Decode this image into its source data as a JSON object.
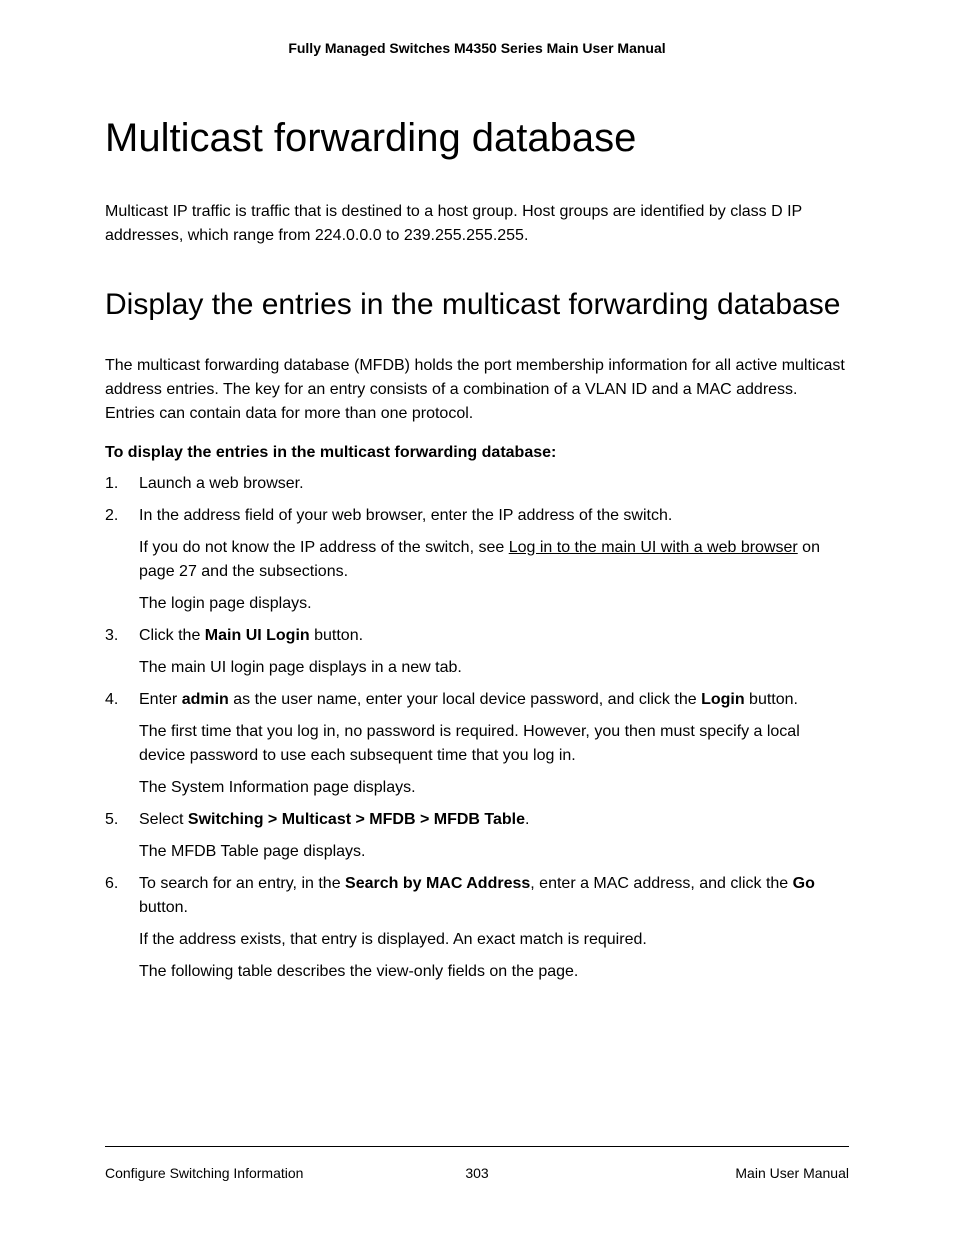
{
  "header": "Fully Managed Switches M4350 Series Main User Manual",
  "h1": "Multicast forwarding database",
  "intro": "Multicast IP traffic is traffic that is destined to a host group. Host groups are identified by class D IP addresses, which range from 224.0.0.0 to 239.255.255.255.",
  "h2": "Display the entries in the multicast forwarding database",
  "desc": "The multicast forwarding database (MFDB) holds the port membership information for all active multicast address entries. The key for an entry consists of a combination of a VLAN ID and a MAC address. Entries can contain data for more than one protocol.",
  "procedure_heading": "To display the entries in the multicast forwarding database:",
  "steps": {
    "s1": "Launch a web browser.",
    "s2": {
      "main": "In the address field of your web browser, enter the IP address of the switch.",
      "help_prefix": "If you do not know the IP address of the switch, see ",
      "help_link": "Log in to the main UI with a web browser",
      "help_suffix": " on page 27 and the subsections.",
      "result": "The login page displays."
    },
    "s3": {
      "prefix": "Click the ",
      "bold": "Main UI Login",
      "suffix": " button.",
      "result": "The main UI login page displays in a new tab."
    },
    "s4": {
      "prefix": "Enter ",
      "bold1": "admin",
      "mid": " as the user name, enter your local device password, and click the ",
      "bold2": "Login",
      "suffix": " button.",
      "note": "The first time that you log in, no password is required. However, you then must specify a local device password to use each subsequent time that you log in.",
      "result": "The System Information page displays."
    },
    "s5": {
      "prefix": "Select ",
      "bold": "Switching > Multicast > MFDB > MFDB Table",
      "suffix": ".",
      "result": "The MFDB Table page displays."
    },
    "s6": {
      "prefix": "To search for an entry, in the ",
      "bold1": "Search by MAC Address",
      "mid": ", enter a MAC address, and click the ",
      "bold2": "Go",
      "suffix": " button.",
      "note": "If the address exists, that entry is displayed. An exact match is required.",
      "result": "The following table describes the view-only fields on the page."
    }
  },
  "footer": {
    "left": "Configure Switching Information",
    "center": "303",
    "right": "Main User Manual"
  }
}
